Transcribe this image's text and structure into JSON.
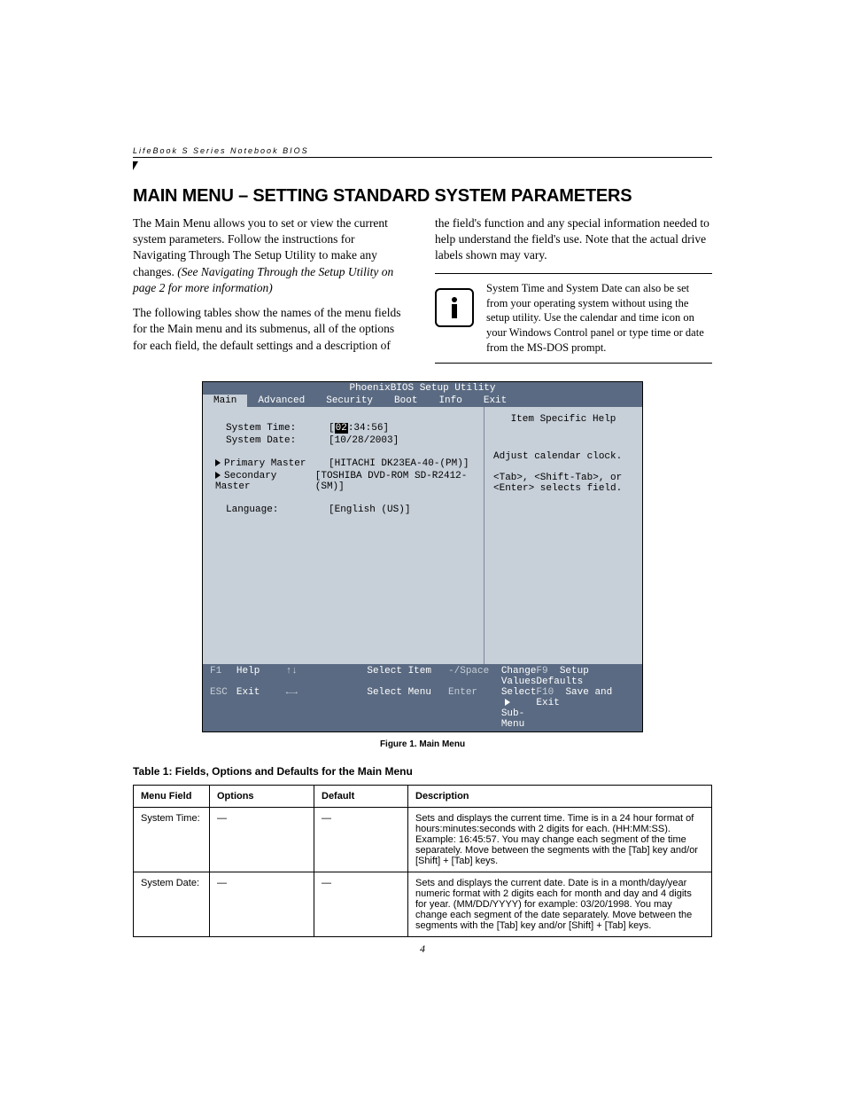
{
  "header": {
    "running_title": "LifeBook S Series Notebook BIOS"
  },
  "title": "MAIN MENU – SETTING STANDARD SYSTEM PARAMETERS",
  "paragraphs": {
    "p1": "The Main Menu allows you to set or view the current system parameters. Follow the instructions for Navigating Through The Setup Utility to make any changes.",
    "p1_ital": "(See Navigating Through the Setup Utility on page 2 for more information)",
    "p2a": "The following tables show the names of the menu fields for the Main menu and its submenus, all of the options for each field, the default settings and a description of",
    "p2b": "the field's function and any special information needed to help understand the field's use. Note that the actual drive labels shown may vary.",
    "info": "System Time and System Date can also be set from your operating system without using the setup utility. Use the calendar and time icon on your Windows Control panel or type time or date from the MS-DOS prompt."
  },
  "bios": {
    "title": "PhoenixBIOS Setup Utility",
    "tabs": [
      "Main",
      "Advanced",
      "Security",
      "Boot",
      "Info",
      "Exit"
    ],
    "rows": {
      "time_label": "System Time:",
      "time_open": "[",
      "time_hh": "02",
      "time_rest": ":34:56]",
      "date_label": "System Date:",
      "date_value": "[10/28/2003]",
      "pm_label": "Primary Master",
      "pm_value": "[HITACHI DK23EA-40-(PM)]",
      "sm_label": "Secondary Master",
      "sm_value": "[TOSHIBA DVD-ROM SD-R2412-(SM)]",
      "lang_label": "Language:",
      "lang_value": "[English (US)]"
    },
    "help": {
      "title": "Item Specific Help",
      "line1": "Adjust calendar clock.",
      "line2": "<Tab>, <Shift-Tab>, or",
      "line3": "<Enter> selects field."
    },
    "footer": {
      "f1_key": "F1",
      "f1_label": "Help",
      "nav1_sym": "↑↓",
      "nav1_label": "Select Item",
      "act1_sym": "-/Space",
      "act1_label": "Change Values",
      "f9_key": "F9",
      "f9_label": "Setup Defaults",
      "esc_key": "ESC",
      "esc_label": "Exit",
      "nav2_sym": "←→",
      "nav2_label": "Select Menu",
      "act2_sym": "Enter",
      "act2_label_a": "Select",
      "act2_label_b": "Sub-Menu",
      "f10_key": "F10",
      "f10_label": "Save and Exit"
    }
  },
  "figure_caption": "Figure 1.   Main Menu",
  "table_title": "Table 1: Fields, Options and Defaults for the Main Menu",
  "table": {
    "headers": {
      "h1": "Menu Field",
      "h2": "Options",
      "h3": "Default",
      "h4": "Description"
    },
    "rows": [
      {
        "field": "System Time:",
        "options": "—",
        "def": "—",
        "desc": "Sets and displays the current time. Time is in a 24 hour format of hours:minutes:seconds with 2 digits for each. (HH:MM:SS). Example: 16:45:57. You may change each segment of the time separately. Move between the segments with the [Tab] key and/or [Shift] + [Tab] keys."
      },
      {
        "field": "System Date:",
        "options": "—",
        "def": "—",
        "desc": "Sets and displays the current date. Date is in a month/day/year numeric format with 2 digits each for month and day and 4 digits for year. (MM/DD/YYYY) for example: 03/20/1998. You may change each segment of the date separately. Move between the segments with the [Tab] key and/or [Shift] + [Tab] keys."
      }
    ]
  },
  "page_number": "4"
}
